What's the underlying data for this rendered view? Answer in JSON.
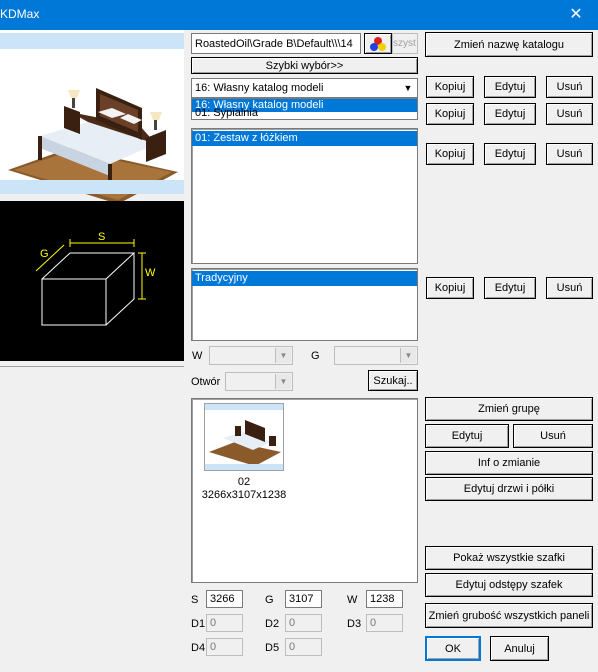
{
  "window": {
    "title": "KDMax",
    "close_glyph": "✕"
  },
  "path": {
    "value": "RoastedOil\\Grade B\\Default\\\\\\14",
    "side_label": "szyst"
  },
  "quick_select_label": "Szybki wybór>>",
  "catalog_combo": {
    "value": "16: Własny katalog modeli",
    "dropdown_items": [
      "16: Własny katalog modeli"
    ],
    "partial_item_behind": "01: Sypialnia"
  },
  "model_list": {
    "items": [
      "01: Zestaw z łóżkiem"
    ]
  },
  "style_list": {
    "items": [
      "Tradycyjny"
    ]
  },
  "filters": {
    "w_label": "W",
    "g_label": "G",
    "otwor_label": "Otwór",
    "search_label": "Szukaj.."
  },
  "thumbnail": {
    "name": "02",
    "size": "3266x3107x1238"
  },
  "diagram": {
    "s": "S",
    "g": "G",
    "w": "W"
  },
  "dimensions": {
    "s_label": "S",
    "s_value": "3266",
    "g_label": "G",
    "g_value": "3107",
    "w_label": "W",
    "w_value": "1238",
    "d1_label": "D1",
    "d1_value": "0",
    "d2_label": "D2",
    "d2_value": "0",
    "d3_label": "D3",
    "d3_value": "0",
    "d4_label": "D4",
    "d4_value": "0",
    "d5_label": "D5",
    "d5_value": "0"
  },
  "right_panel": {
    "rename_catalog": "Zmień nazwę katalogu",
    "kopiuj": "Kopiuj",
    "edytuj": "Edytuj",
    "usun": "Usuń",
    "change_group": "Zmień grupę",
    "info_change": "Inf o zmianie",
    "edit_doors": "Edytuj drzwi i półki",
    "show_all": "Pokaż wszystkie szafki",
    "edit_gaps": "Edytuj odstępy szafek",
    "change_thickness": "Zmień grubość wszystkich paneli",
    "ok": "OK",
    "cancel": "Anuluj"
  },
  "colors": {
    "titlebar": "#0078d7",
    "selection": "#0078d7",
    "preview_band": "#cce4f7",
    "diagram_line": "#ffff00"
  }
}
